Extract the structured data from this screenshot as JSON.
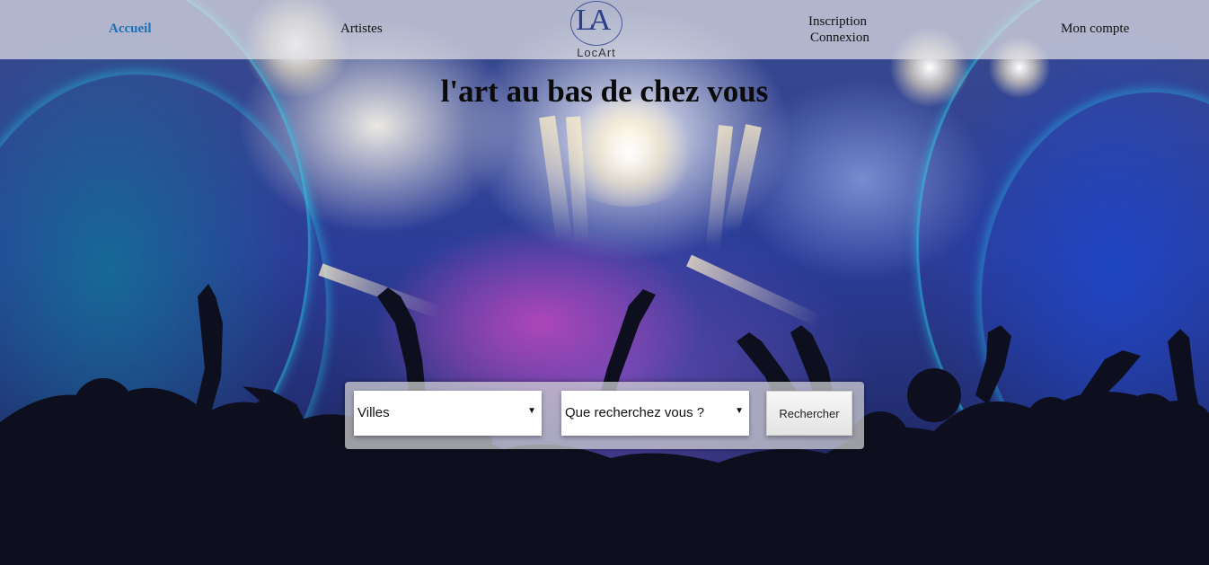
{
  "nav": {
    "home": "Accueil",
    "artists": "Artistes",
    "signup": "Inscription",
    "login": "Connexion",
    "account": "Mon compte"
  },
  "logo": {
    "letters": "LA",
    "name": "LocArt"
  },
  "hero": {
    "title": "l'art au bas de chez vous"
  },
  "search": {
    "city_select": "Villes",
    "type_select": "Que recherchez vous ?",
    "submit": "Rechercher"
  },
  "colors": {
    "active_link": "#1d6fb8",
    "logo": "#2c3f86"
  }
}
